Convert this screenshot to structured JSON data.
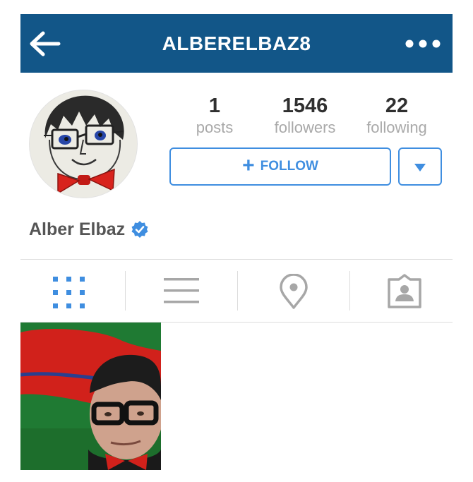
{
  "header": {
    "username": "ALBERELBAZ8",
    "back_icon": "arrow-left-icon",
    "more_icon": "more-horizontal-icon",
    "background": "#125688"
  },
  "profile": {
    "full_name": "Alber Elbaz",
    "verified": true,
    "stats": [
      {
        "value": "1",
        "label": "posts"
      },
      {
        "value": "1546",
        "label": "followers"
      },
      {
        "value": "22",
        "label": "following"
      }
    ],
    "follow_label": "FOLLOW",
    "accent": "#3f8ee0"
  },
  "tabs": [
    {
      "id": "grid",
      "icon": "grid-icon",
      "active": true
    },
    {
      "id": "list",
      "icon": "list-icon",
      "active": false
    },
    {
      "id": "map",
      "icon": "location-pin-icon",
      "active": false
    },
    {
      "id": "tagged",
      "icon": "tagged-photos-icon",
      "active": false
    }
  ],
  "posts": [
    {
      "alt": "selfie-photo",
      "icon": "photo-thumbnail"
    }
  ]
}
